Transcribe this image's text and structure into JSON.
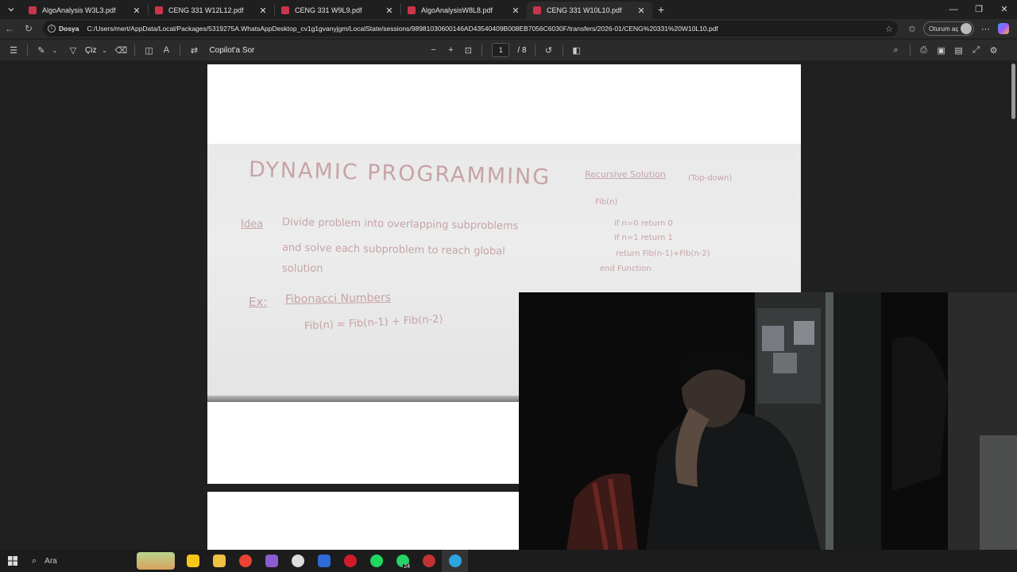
{
  "tabs": [
    {
      "label": "AlgoAnalysis W3L3.pdf",
      "active": false
    },
    {
      "label": "CENG 331 W12L12.pdf",
      "active": false
    },
    {
      "label": "CENG 331 W9L9.pdf",
      "active": false
    },
    {
      "label": "AlgoAnalysisW8L8.pdf",
      "active": false
    },
    {
      "label": "CENG 331 W10L10.pdf",
      "active": true
    }
  ],
  "new_tab": "+",
  "address": {
    "scheme": "Dosya",
    "url": "C:/Users/mert/AppData/Local/Packages/5319275A.WhatsAppDesktop_cv1g1gvanyjgm/LocalState/sessions/98981030600146AD43540409B008EB7056C6030F/transfers/2026-01/CENG%20331%20W10L10.pdf",
    "signin_label": "Oturum aç"
  },
  "pdf_toolbar": {
    "draw_label": "Çiz",
    "copilot_label": "Copilot'a Sor",
    "page_current": "1",
    "page_total": "/ 8"
  },
  "whiteboard": {
    "title": "DYNAMIC PROGRAMMING",
    "idea_tag": "Idea",
    "idea_line1": "Divide problem into overlapping subproblems",
    "idea_line2": "and solve each subproblem to reach global",
    "idea_line3": "solution",
    "ex_tag": "Ex:",
    "ex_title": "Fibonacci Numbers",
    "ex_formula": "Fib(n) = Fib(n-1) + Fib(n-2)",
    "rec_title": "Recursive Solution",
    "rec_note": "(Top-down)",
    "rec_l1": "Fib(n)",
    "rec_l2": "if n=0 return 0",
    "rec_l3": "if n=1 return 1",
    "rec_l4": "return Fib(n-1)+Fib(n-2)",
    "rec_l5": "end Function"
  },
  "taskbar": {
    "search_label": "Ara",
    "whatsapp_badge": "24",
    "apps": [
      {
        "name": "sticky-notes",
        "color": "#f5c518"
      },
      {
        "name": "file-explorer",
        "color": "#f0c040"
      },
      {
        "name": "chrome",
        "color": "#ea4335"
      },
      {
        "name": "visual-studio",
        "color": "#8a5cd0"
      },
      {
        "name": "app-5",
        "color": "#dddddd"
      },
      {
        "name": "app-6",
        "color": "#2f6ad9"
      },
      {
        "name": "opera",
        "color": "#d01c2a"
      },
      {
        "name": "spotify",
        "color": "#1ed760"
      },
      {
        "name": "whatsapp",
        "color": "#25d366"
      },
      {
        "name": "app-10",
        "color": "#c33333"
      },
      {
        "name": "edge",
        "color": "#2aa6e0"
      }
    ]
  },
  "colors": {
    "accent_pdf": "#c9354a",
    "whiteboard_ink": "#c7a3a6"
  }
}
